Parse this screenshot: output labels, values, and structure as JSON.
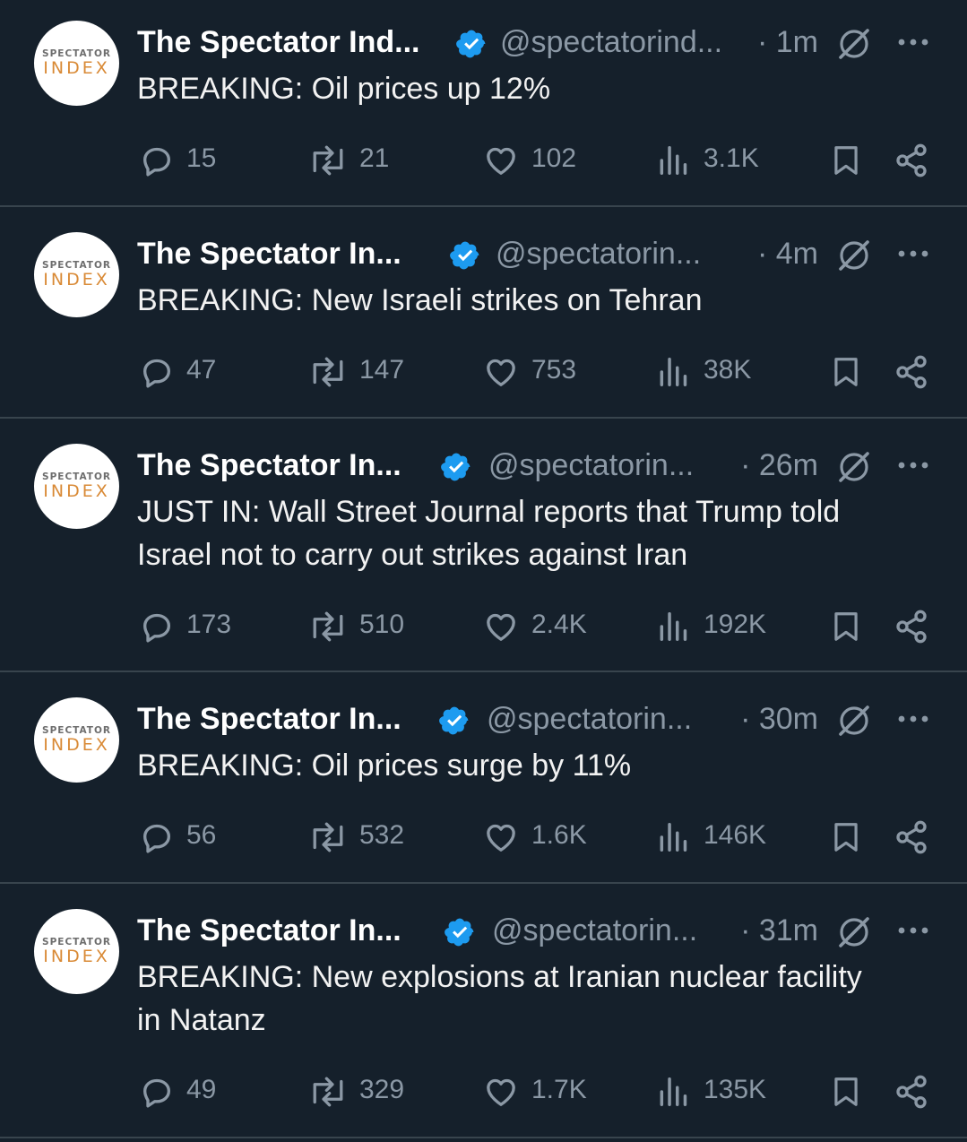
{
  "tweets": [
    {
      "name": "The Spectator Ind...",
      "handle": "@spectatorind...",
      "time": "· 1m",
      "text_lines": [
        "BREAKING: Oil prices up 12%"
      ],
      "replies": "15",
      "reposts": "21",
      "likes": "102",
      "views": "3.1K"
    },
    {
      "name": "The Spectator In...",
      "handle": "@spectatorin...",
      "time": "· 4m",
      "text_lines": [
        "BREAKING: New Israeli strikes on Tehran"
      ],
      "replies": "47",
      "reposts": "147",
      "likes": "753",
      "views": "38K"
    },
    {
      "name": "The Spectator In...",
      "handle": "@spectatorin...",
      "time": "· 26m",
      "text_lines": [
        "JUST IN: Wall Street Journal reports that Trump told",
        "Israel not to carry out strikes against Iran"
      ],
      "replies": "173",
      "reposts": "510",
      "likes": "2.4K",
      "views": "192K"
    },
    {
      "name": "The Spectator In...",
      "handle": "@spectatorin...",
      "time": "· 30m",
      "text_lines": [
        "BREAKING: Oil prices surge by 11%"
      ],
      "replies": "56",
      "reposts": "532",
      "likes": "1.6K",
      "views": "146K"
    },
    {
      "name": "The Spectator In...",
      "handle": "@spectatorin...",
      "time": "· 31m",
      "text_lines": [
        "BREAKING: New explosions at Iranian nuclear facility",
        "in Natanz"
      ],
      "replies": "49",
      "reposts": "329",
      "likes": "1.7K",
      "views": "135K"
    }
  ],
  "avatar": {
    "logo_top": "SPECTATOR",
    "logo_bottom": "INDEX"
  },
  "icons": {
    "verified": "verified-badge-icon",
    "grok": "grok-icon",
    "more": "more-options-icon",
    "reply": "reply-icon",
    "repost": "repost-icon",
    "like": "heart-icon",
    "views": "views-chart-icon",
    "bookmark": "bookmark-icon",
    "share": "share-icon"
  },
  "colors": {
    "background": "#15202b",
    "divider": "#38444d",
    "secondary_text": "#8b98a5",
    "verified_blue": "#1d9bf0",
    "logo_orange": "#d98a36"
  }
}
